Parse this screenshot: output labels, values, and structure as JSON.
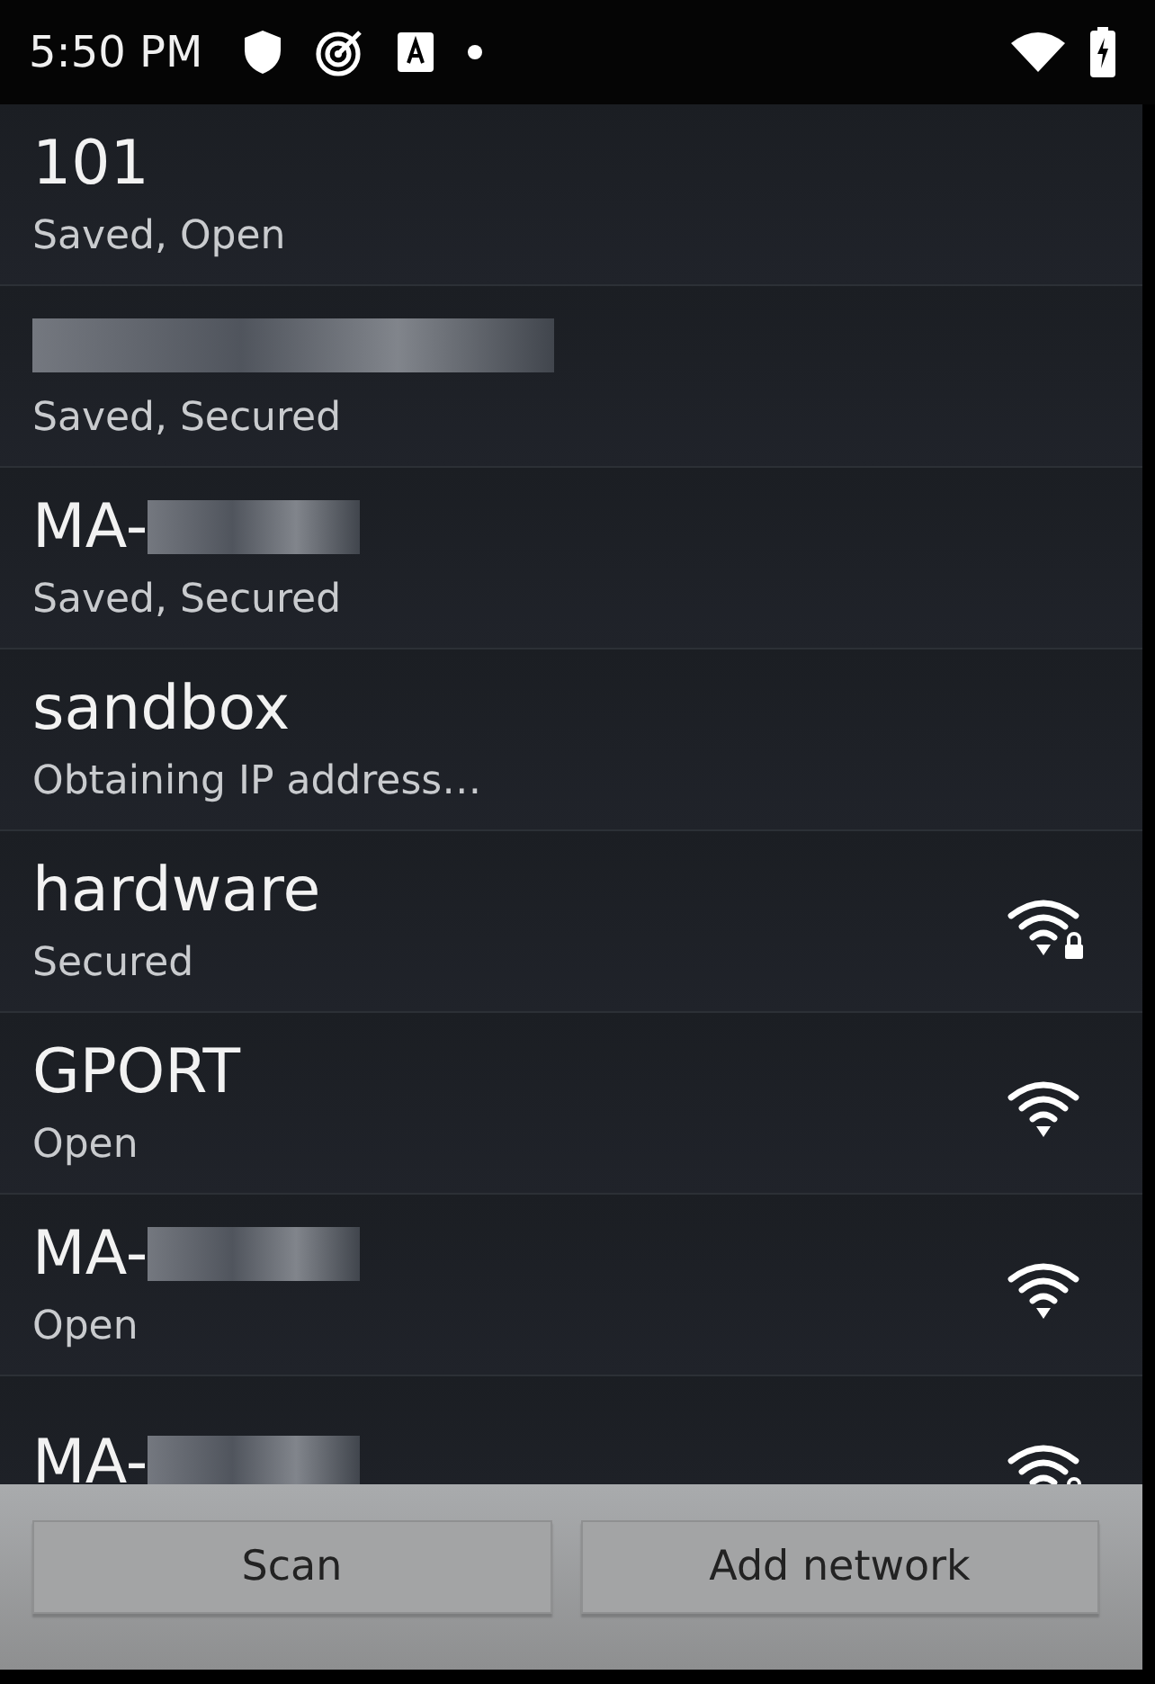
{
  "status_bar": {
    "time": "5:50 PM"
  },
  "networks": [
    {
      "ssid": "101",
      "redacted": false,
      "status": "Saved, Open",
      "in_range": false
    },
    {
      "redacted": true,
      "status": "Saved, Secured",
      "in_range": false
    },
    {
      "ssid": "MA-",
      "redacted": true,
      "status": "Saved, Secured",
      "in_range": false
    },
    {
      "ssid": "sandbox",
      "redacted": false,
      "status": "Obtaining IP address…",
      "in_range": false
    },
    {
      "ssid": "hardware",
      "redacted": false,
      "status": "Secured",
      "in_range": true,
      "secured": true
    },
    {
      "ssid": "GPORT",
      "redacted": false,
      "status": "Open",
      "in_range": true,
      "secured": false
    },
    {
      "ssid": "MA-",
      "redacted": true,
      "status": "Open",
      "in_range": true,
      "secured": false
    },
    {
      "ssid": "MA-",
      "redacted": true,
      "in_range": true,
      "secured": true
    }
  ],
  "buttons": [
    "Scan",
    "Add network"
  ]
}
